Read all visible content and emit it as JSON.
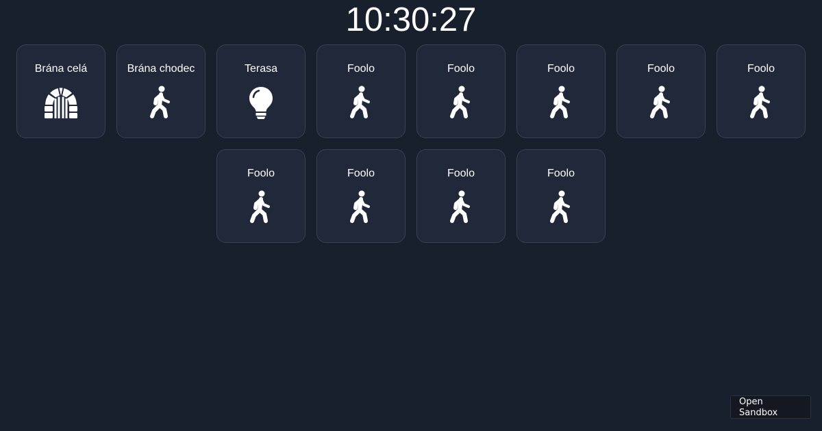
{
  "clock": {
    "time": "10:30:27"
  },
  "tiles": [
    {
      "label": "Brána celá",
      "icon": "gate-arch-icon"
    },
    {
      "label": "Brána chodec",
      "icon": "walk-icon"
    },
    {
      "label": "Terasa",
      "icon": "lightbulb-icon"
    },
    {
      "label": "Foolo",
      "icon": "walk-icon"
    },
    {
      "label": "Foolo",
      "icon": "walk-icon"
    },
    {
      "label": "Foolo",
      "icon": "walk-icon"
    },
    {
      "label": "Foolo",
      "icon": "walk-icon"
    },
    {
      "label": "Foolo",
      "icon": "walk-icon"
    },
    {
      "label": "Foolo",
      "icon": "walk-icon"
    },
    {
      "label": "Foolo",
      "icon": "walk-icon"
    },
    {
      "label": "Foolo",
      "icon": "walk-icon"
    },
    {
      "label": "Foolo",
      "icon": "walk-icon"
    }
  ],
  "sandbox_button": {
    "label": "Open Sandbox"
  },
  "colors": {
    "background": "#18202e",
    "tile_background": "#202839",
    "tile_border": "#3a4252",
    "text": "#ffffff"
  }
}
